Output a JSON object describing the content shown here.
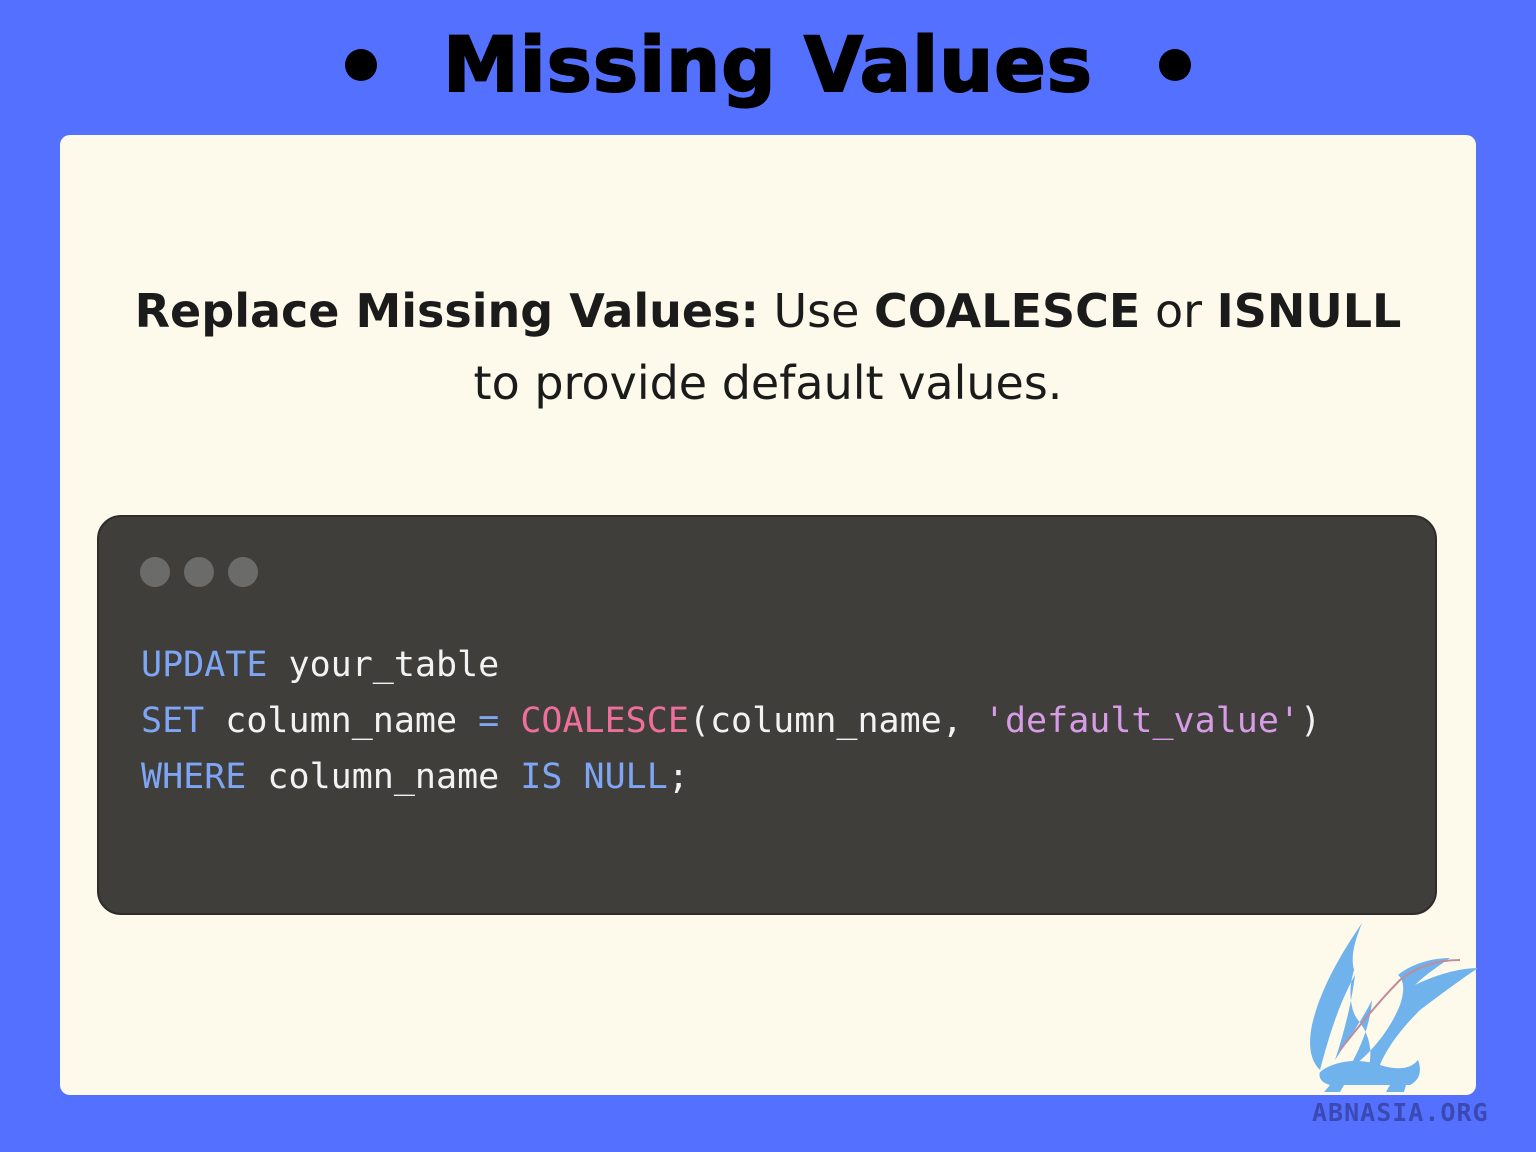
{
  "header": {
    "title": "Missing Values"
  },
  "description": {
    "bold_lead": "Replace Missing Values:",
    "text_1": " Use ",
    "bold_1": "COALESCE",
    "text_2": " or ",
    "bold_2": "ISNULL",
    "text_3": "to provide default values."
  },
  "code": {
    "lines": [
      [
        {
          "t": "UPDATE",
          "c": "kw"
        },
        {
          "t": " your_table",
          "c": "plain"
        }
      ],
      [
        {
          "t": "SET",
          "c": "kw"
        },
        {
          "t": " column_name ",
          "c": "plain"
        },
        {
          "t": "=",
          "c": "kw"
        },
        {
          "t": " ",
          "c": "plain"
        },
        {
          "t": "COALESCE",
          "c": "fn"
        },
        {
          "t": "(column_name, ",
          "c": "plain"
        },
        {
          "t": "'default_value'",
          "c": "str"
        },
        {
          "t": ")",
          "c": "plain"
        }
      ],
      [
        {
          "t": "WHERE",
          "c": "kw"
        },
        {
          "t": " column_name ",
          "c": "plain"
        },
        {
          "t": "IS",
          "c": "kw"
        },
        {
          "t": " ",
          "c": "plain"
        },
        {
          "t": "NULL",
          "c": "kw"
        },
        {
          "t": ";",
          "c": "plain"
        }
      ]
    ]
  },
  "footer": {
    "site": "ABNASIA.ORG"
  },
  "colors": {
    "background": "#5470ff",
    "card": "#fdfaeb",
    "code_bg": "#3f3e3b",
    "keyword": "#7ea6f5",
    "function": "#ef6f9c",
    "string": "#d79ce6"
  }
}
